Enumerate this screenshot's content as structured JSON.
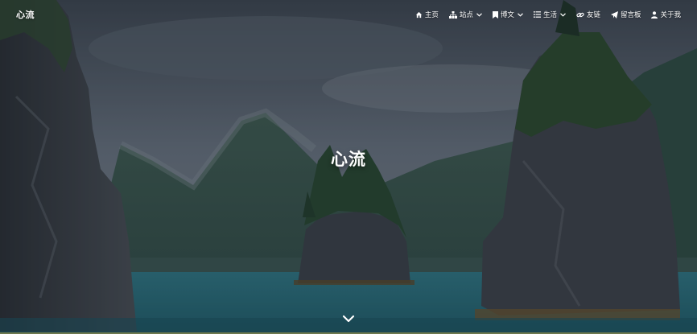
{
  "brand": "心流",
  "hero_title": "心流",
  "nav": {
    "home": "主页",
    "site": "站点",
    "posts": "博文",
    "life": "生活",
    "links": "友链",
    "guestbook": "留言板",
    "about": "关于我"
  },
  "icons": {
    "home": "home-icon",
    "site": "sitemap-icon",
    "posts": "bookmark-icon",
    "life": "list-icon",
    "links": "link-icon",
    "guestbook": "paper-plane-icon",
    "about": "user-icon",
    "scroll": "chevron-down-icon"
  },
  "colors": {
    "sky": "#4f5a66",
    "water": "#2f7f8c",
    "forest": "#2e4f3e",
    "rock": "#3b3f45"
  }
}
